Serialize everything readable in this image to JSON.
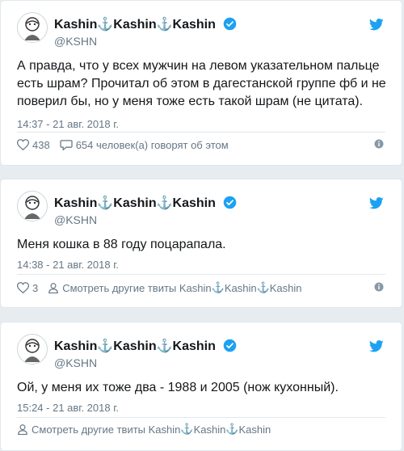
{
  "tweets": [
    {
      "name_parts": [
        "Kashin",
        "⚓",
        "Kashin",
        "⚓",
        "Kashin"
      ],
      "handle": "@KSHN",
      "text": "А правда, что у всех мужчин на левом указательном пальце есть шрам? Прочитал об этом в дагестанской группе фб и не поверил бы, но у меня тоже есть такой шрам (не цитата).",
      "timestamp": "14:37 - 21 авг. 2018 г.",
      "likes": "438",
      "secondary": "654 человек(а) говорят об этом"
    },
    {
      "name_parts": [
        "Kashin",
        "⚓",
        "Kashin",
        "⚓",
        "Kashin"
      ],
      "handle": "@KSHN",
      "text": "Меня кошка в 88 году поцарапала.",
      "timestamp": "14:38 - 21 авг. 2018 г.",
      "likes": "3",
      "secondary_parts": [
        "Смотреть другие твиты Kashin",
        "⚓",
        "Kashin",
        "⚓",
        "Kashin"
      ]
    },
    {
      "name_parts": [
        "Kashin",
        "⚓",
        "Kashin",
        "⚓",
        "Kashin"
      ],
      "handle": "@KSHN",
      "text": "Ой, у меня их тоже два - 1988 и 2005 (нож кухонный).",
      "timestamp": "15:24 - 21 авг. 2018 г.",
      "secondary_parts": [
        "Смотреть другие твиты Kashin",
        "⚓",
        "Kashin",
        "⚓",
        "Kashin"
      ]
    }
  ],
  "colors": {
    "accent": "#1da1f2",
    "muted": "#657786",
    "text": "#14171a",
    "border": "#e1e8ed",
    "background": "#e6ecf0"
  },
  "icons": [
    "avatar",
    "verified-badge-icon",
    "twitter-bird-icon",
    "heart-icon",
    "comment-icon",
    "person-icon",
    "info-icon"
  ]
}
